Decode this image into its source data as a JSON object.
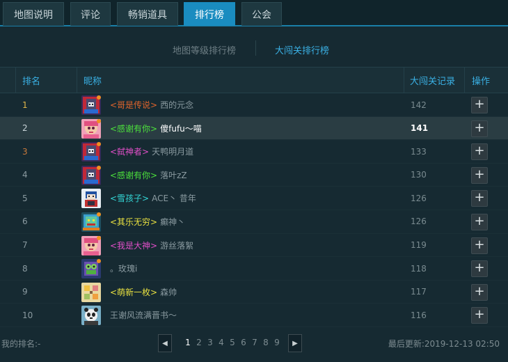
{
  "tabs": [
    {
      "label": "地图说明",
      "active": false
    },
    {
      "label": "评论",
      "active": false
    },
    {
      "label": "畅销道具",
      "active": false
    },
    {
      "label": "排行榜",
      "active": true
    },
    {
      "label": "公会",
      "active": false
    }
  ],
  "subtabs": [
    {
      "label": "地图等级排行榜",
      "active": false
    },
    {
      "label": "大闯关排行榜",
      "active": true
    }
  ],
  "columns": {
    "rank": "排名",
    "nickname": "昵称",
    "record": "大闯关记录",
    "action": "操作"
  },
  "rows": [
    {
      "rank": "1",
      "title": "<哥是传说>",
      "title_color": "#e0642c",
      "name": "西的元念",
      "record": "142",
      "avatar": "dark-knight"
    },
    {
      "rank": "2",
      "title": "<感谢有你>",
      "title_color": "#4ce03c",
      "name": "傻fufu～喵",
      "record": "141",
      "avatar": "pink-girl"
    },
    {
      "rank": "3",
      "title": "<弑神者>",
      "title_color": "#e04fc8",
      "name": "天鸭明月道",
      "record": "133",
      "avatar": "dark-knight"
    },
    {
      "rank": "4",
      "title": "<感谢有你>",
      "title_color": "#4ce03c",
      "name": "落叶zZ",
      "record": "130",
      "avatar": "dark-knight"
    },
    {
      "rank": "5",
      "title": "<雪孩子>",
      "title_color": "#34d8d8",
      "name": "ACE丶 昔年",
      "record": "126",
      "avatar": "snow-kid"
    },
    {
      "rank": "6",
      "title": "<其乐无穷>",
      "title_color": "#e8e040",
      "name": "癫神丶",
      "record": "126",
      "avatar": "blue-dragon"
    },
    {
      "rank": "7",
      "title": "<我是大神>",
      "title_color": "#e04fc8",
      "name": "游丝落絮",
      "record": "119",
      "avatar": "pink-girl"
    },
    {
      "rank": "8",
      "title": "",
      "title_color": "#8a9aa0",
      "name": "。玫瑰i",
      "record": "118",
      "avatar": "frog"
    },
    {
      "rank": "9",
      "title": "<萌新一枚>",
      "title_color": "#e8e040",
      "name": "森帅",
      "record": "117",
      "avatar": "yellow-pixel"
    },
    {
      "rank": "10",
      "title": "",
      "title_color": "#8a9aa0",
      "name": "王谢风流满晋书～",
      "record": "116",
      "avatar": "panda"
    }
  ],
  "action_symbol": "+",
  "footer": {
    "my_rank": "我的排名:-",
    "prev_icon": "◀",
    "next_icon": "▶",
    "pages": [
      "1",
      "2",
      "3",
      "4",
      "5",
      "6",
      "7",
      "8",
      "9"
    ],
    "current_page": "1",
    "last_updated": "最后更新:2019-12-13 02:50"
  },
  "colors": {
    "accent": "#1a8cc0",
    "header_text": "#3ab0e4",
    "background": "#162a32"
  }
}
